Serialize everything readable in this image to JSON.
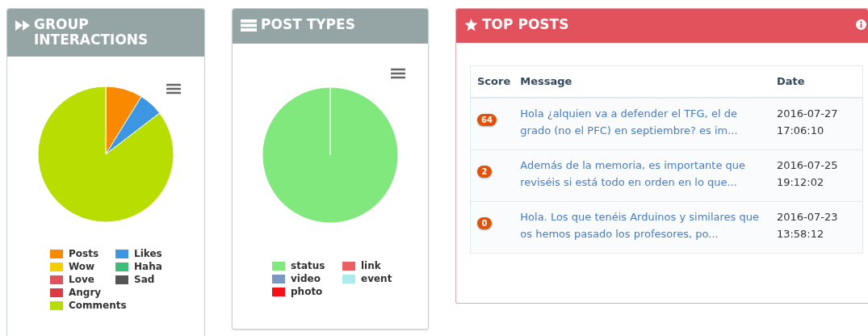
{
  "group_interactions": {
    "title": "GROUP INTERACTIONS",
    "legend": [
      {
        "label": "Posts",
        "color": "#f98a00"
      },
      {
        "label": "Likes",
        "color": "#3d96e2"
      },
      {
        "label": "Wow",
        "color": "#f5d000"
      },
      {
        "label": "Haha",
        "color": "#3bbd78"
      },
      {
        "label": "Love",
        "color": "#e0525c"
      },
      {
        "label": "Sad",
        "color": "#555555"
      },
      {
        "label": "Angry",
        "color": "#dc3b44"
      },
      {
        "label": "Comments",
        "color": "#b8dd00"
      }
    ]
  },
  "post_types": {
    "title": "POST TYPES",
    "legend": [
      {
        "label": "status",
        "color": "#80e87c"
      },
      {
        "label": "link",
        "color": "#ea5f5f"
      },
      {
        "label": "video",
        "color": "#7a98c4"
      },
      {
        "label": "event",
        "color": "#aeeceb"
      },
      {
        "label": "photo",
        "color": "#f6101a"
      }
    ]
  },
  "top_posts": {
    "title": "TOP POSTS",
    "columns": [
      "Score",
      "Message",
      "Date"
    ],
    "rows": [
      {
        "score": "64",
        "message": "Hola ¿alquien va a defender el TFG, el de grado (no el PFC) en septiembre? es im...",
        "date": "2016-07-27 17:06:10"
      },
      {
        "score": "2",
        "message": "Además de la memoria, es importante que reviséis si está todo en orden en lo que...",
        "date": "2016-07-25 19:12:02"
      },
      {
        "score": "0",
        "message": "Hola. Los que tenéis Arduinos y similares que os hemos pasado los profesores, po...",
        "date": "2016-07-23 13:58:12"
      }
    ]
  }
}
